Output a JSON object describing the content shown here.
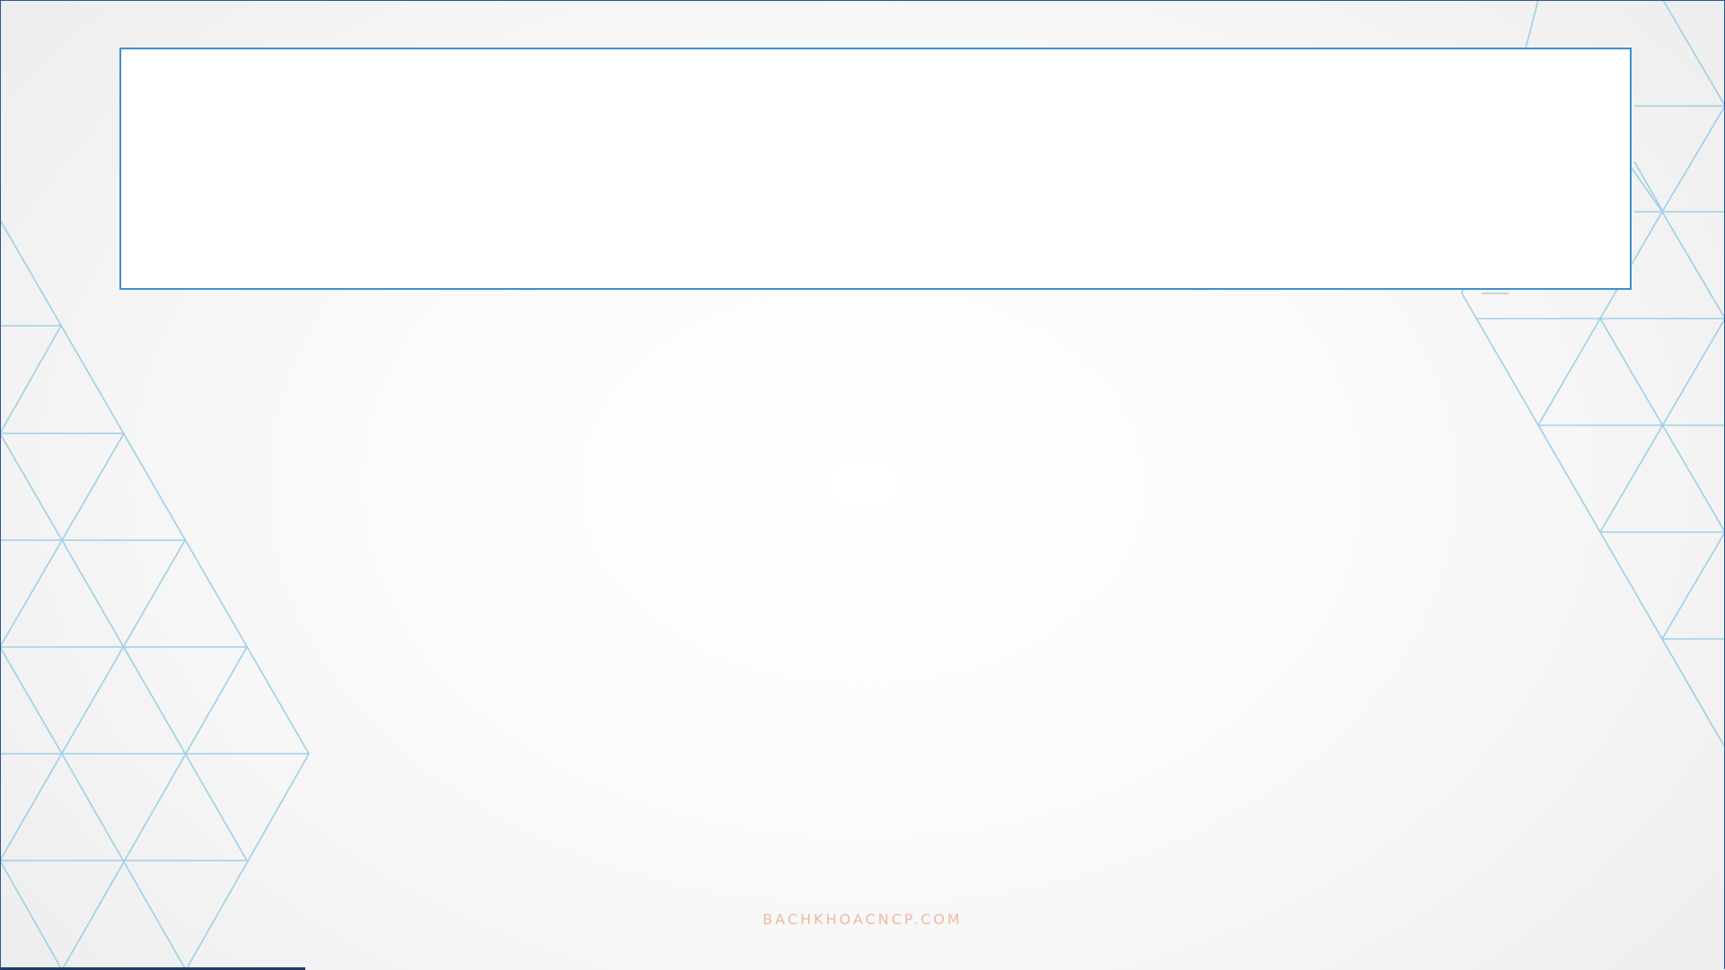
{
  "slide": {
    "title": "",
    "watermark": "BACHKHOACNCP.COM"
  },
  "colors": {
    "frame": "#2f5597",
    "title_border": "#3f8fcf",
    "triangle_lines": "#9fd0e6",
    "watermark": "#efb8a3"
  }
}
